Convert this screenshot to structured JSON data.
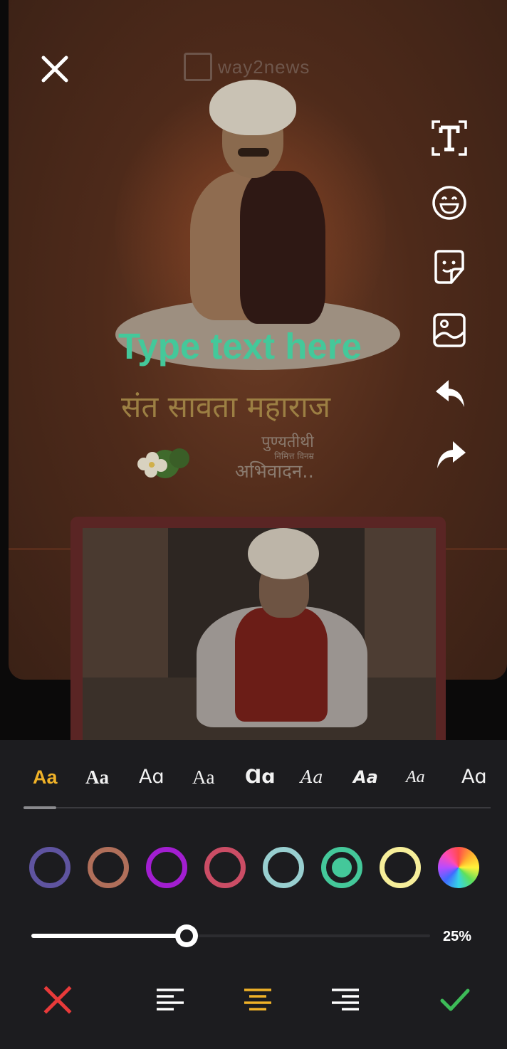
{
  "canvas": {
    "watermark_text": "way2news",
    "placeholder_text": "Type text here",
    "poster_title": "संत सावता महाराज",
    "poster_line1": "पुण्यतीथी",
    "poster_line2": "निमित्त विनम्र",
    "poster_line3": "अभिवादन..",
    "placeholder_color": "#44c89a"
  },
  "toolbar": {
    "close_icon": "close-icon",
    "tools": [
      {
        "name": "text-tool",
        "icon": "text-frame-icon"
      },
      {
        "name": "emoji-tool",
        "icon": "smiley-icon"
      },
      {
        "name": "sticker-tool",
        "icon": "sticker-icon"
      },
      {
        "name": "image-tool",
        "icon": "image-icon"
      },
      {
        "name": "undo",
        "icon": "undo-icon"
      },
      {
        "name": "redo",
        "icon": "redo-icon"
      }
    ]
  },
  "editor": {
    "fonts": [
      {
        "label": "Aa",
        "selected": true
      },
      {
        "label": "Aa"
      },
      {
        "label": "Aɑ"
      },
      {
        "label": "Aa"
      },
      {
        "label": "Ɑɑ"
      },
      {
        "label": "Aa"
      },
      {
        "label": "Aa"
      },
      {
        "label": "Aa"
      },
      {
        "label": "Aɑ"
      }
    ],
    "colors": [
      {
        "hex": "#5f54a0",
        "selected": false
      },
      {
        "hex": "#b06f5a",
        "selected": false
      },
      {
        "hex": "#a21ed1",
        "selected": false
      },
      {
        "hex": "#cb4d65",
        "selected": false
      },
      {
        "hex": "#98cfd0",
        "selected": false
      },
      {
        "hex": "#44c89a",
        "selected": true
      },
      {
        "hex": "#f6ee9a",
        "selected": false
      },
      {
        "hex": "color-wheel",
        "selected": false
      }
    ],
    "size_slider": {
      "value_percent": 25,
      "label": "25%"
    },
    "actions": {
      "cancel_icon": "cross-icon",
      "align_left_icon": "align-left-icon",
      "align_center_icon": "align-center-icon",
      "align_right_icon": "align-right-icon",
      "confirm_icon": "check-icon",
      "cancel_color": "#e83a3a",
      "confirm_color": "#3dbb58",
      "active_align_color": "#f0b228"
    }
  }
}
